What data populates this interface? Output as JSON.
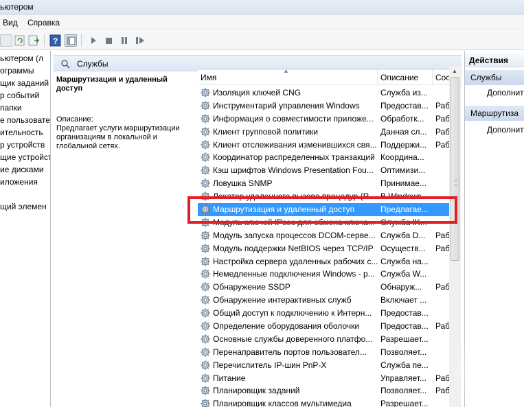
{
  "window": {
    "title": "ьютером"
  },
  "menu": {
    "view": "Вид",
    "help": "Справка"
  },
  "tree": {
    "items": [
      "ьютером (л",
      "ограммы",
      "щик заданий",
      "р событий",
      "папки",
      "е пользовате",
      "ительность",
      "р устройств",
      "щие устройст",
      "ие дисками",
      "иложения",
      "",
      "щий элемен"
    ]
  },
  "center": {
    "header": "Службы",
    "details": {
      "service_name": "Маршрутизация и удаленный доступ",
      "description_label": "Описание:",
      "description_text": "Предлагает услуги маршрутизации организациям в локальной и глобальной сетях."
    }
  },
  "columns": {
    "name": "Имя",
    "description": "Описание",
    "state": "Сос"
  },
  "services": [
    {
      "name": "Изоляция ключей CNG",
      "description": "Служба из...",
      "state": ""
    },
    {
      "name": "Инструментарий управления Windows",
      "description": "Предостав...",
      "state": "Раб"
    },
    {
      "name": "Информация о совместимости приложе...",
      "description": "Обработк...",
      "state": "Раб"
    },
    {
      "name": "Клиент групповой политики",
      "description": "Данная сл...",
      "state": "Раб"
    },
    {
      "name": "Клиент отслеживания изменившихся свя...",
      "description": "Поддержи...",
      "state": "Раб"
    },
    {
      "name": "Координатор распределенных транзакций",
      "description": "Координа...",
      "state": ""
    },
    {
      "name": "Кэш шрифтов Windows Presentation Fou...",
      "description": "Оптимизи...",
      "state": ""
    },
    {
      "name": "Ловушка SNMP",
      "description": "Принимае...",
      "state": ""
    },
    {
      "name": "Локатор удаленного вызова процедур (R...",
      "description": "В Windows...",
      "state": ""
    },
    {
      "name": "Маршрутизация и удаленный доступ",
      "description": "Предлагае...",
      "state": ""
    },
    {
      "name": "Модуль ключей IPsec для обмена ключа...",
      "description": "Служба IK...",
      "state": ""
    },
    {
      "name": "Модуль запуска процессов DCOM-серве...",
      "description": "Служба D...",
      "state": "Раб"
    },
    {
      "name": "Модуль поддержки NetBIOS через TCP/IP",
      "description": "Осуществ...",
      "state": "Раб"
    },
    {
      "name": "Настройка сервера удаленных рабочих с...",
      "description": "Служба на...",
      "state": ""
    },
    {
      "name": "Немедленные подключения Windows - р...",
      "description": "Служба W...",
      "state": ""
    },
    {
      "name": "Обнаружение SSDP",
      "description": "Обнаруж...",
      "state": "Раб"
    },
    {
      "name": "Обнаружение интерактивных служб",
      "description": "Включает ...",
      "state": ""
    },
    {
      "name": "Общий доступ к подключению к Интерн...",
      "description": "Предостав...",
      "state": ""
    },
    {
      "name": "Определение оборудования оболочки",
      "description": "Предостав...",
      "state": "Раб"
    },
    {
      "name": "Основные службы доверенного платфо...",
      "description": "Разрешает...",
      "state": ""
    },
    {
      "name": "Перенаправитель портов пользовател...",
      "description": "Позволяет...",
      "state": ""
    },
    {
      "name": "Перечислитель IP-шин PnP-X",
      "description": "Служба пе...",
      "state": ""
    },
    {
      "name": "Питание",
      "description": "Управляет...",
      "state": "Раб"
    },
    {
      "name": "Планировщик заданий",
      "description": "Позволяет...",
      "state": "Раб"
    },
    {
      "name": "Планировщик классов мультимедиа",
      "description": "Разрешает...",
      "state": ""
    }
  ],
  "selected_index": 9,
  "actions": {
    "header": "Действия",
    "sections": [
      {
        "title": "Службы",
        "item": "Дополнит"
      },
      {
        "title": "Маршрутиза",
        "item": "Дополнит"
      }
    ]
  },
  "colors": {
    "selection": "#3399ff",
    "highlight_box": "#e31e24"
  }
}
